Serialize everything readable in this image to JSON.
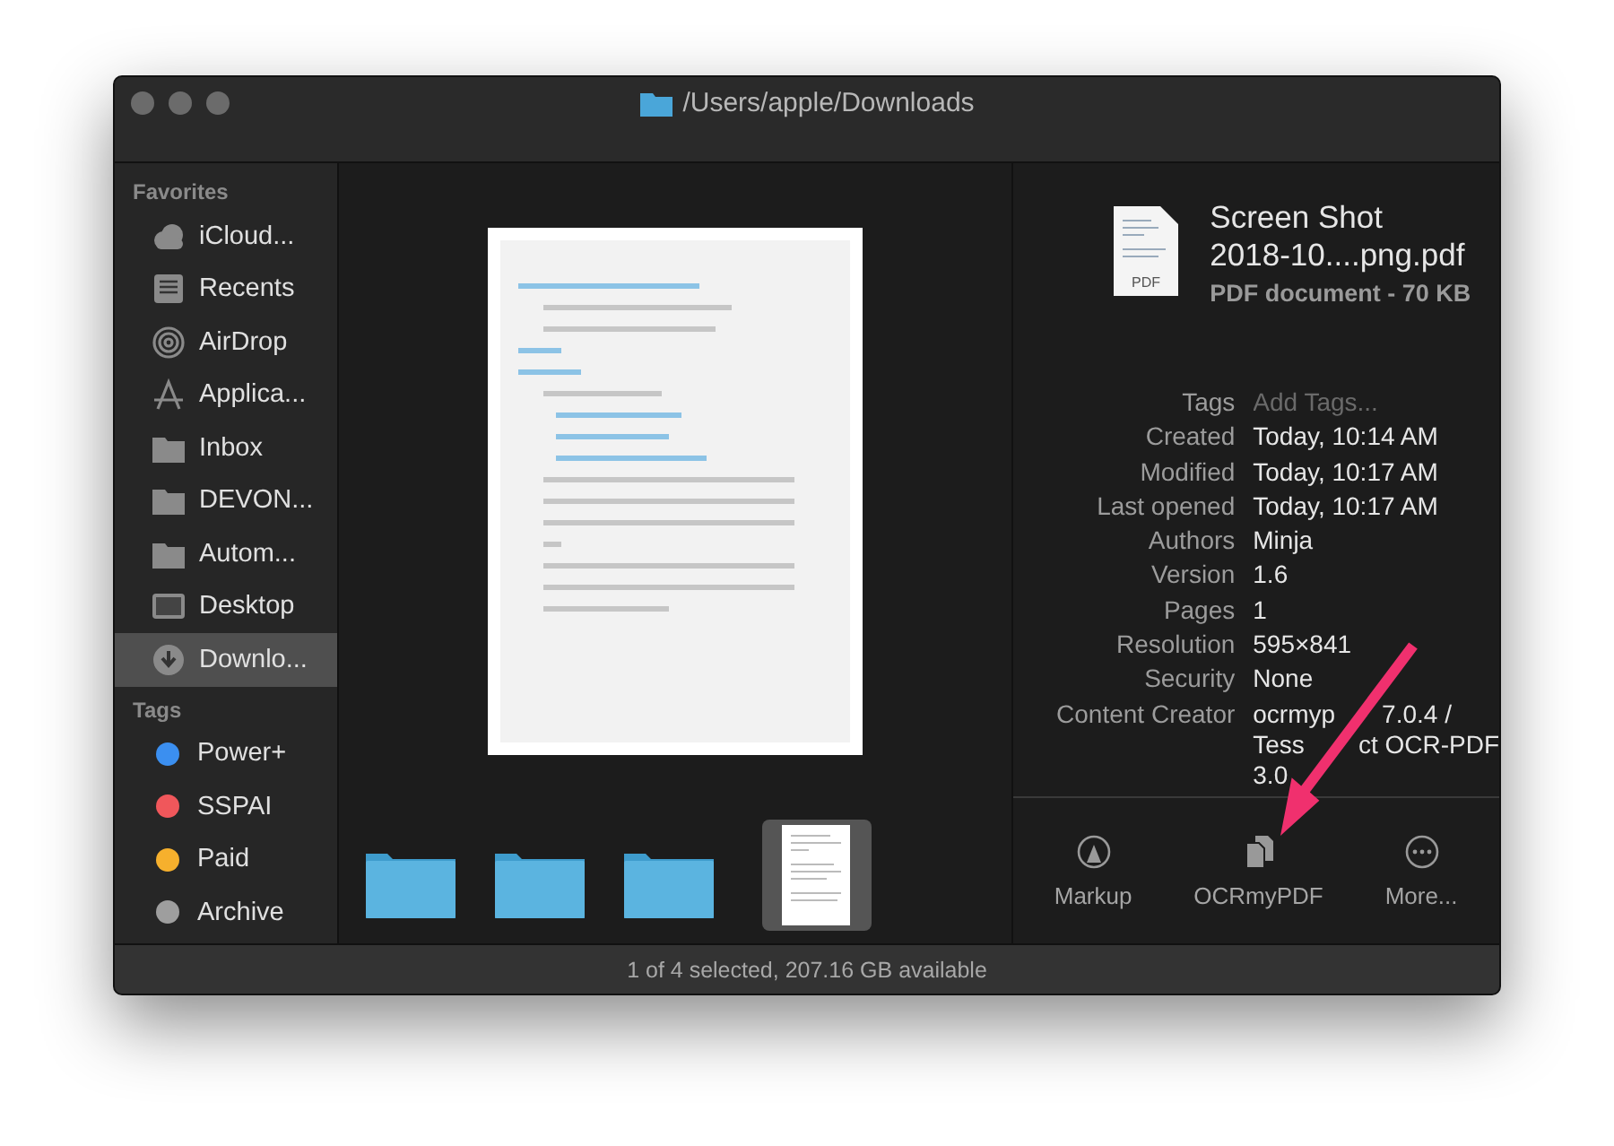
{
  "window": {
    "title": "/Users/apple/Downloads"
  },
  "sidebar": {
    "sections": [
      {
        "title": "Favorites",
        "kind": "places",
        "items": [
          {
            "label": "iCloud...",
            "selected": false
          },
          {
            "label": "Recents",
            "selected": false
          },
          {
            "label": "AirDrop",
            "selected": false
          },
          {
            "label": "Applica...",
            "selected": false
          },
          {
            "label": "Inbox",
            "selected": false
          },
          {
            "label": "DEVON...",
            "selected": false
          },
          {
            "label": "Autom...",
            "selected": false
          },
          {
            "label": "Desktop",
            "selected": false
          },
          {
            "label": "Downlo...",
            "selected": true
          }
        ]
      },
      {
        "title": "Tags",
        "kind": "tags",
        "items": [
          {
            "label": "Power+",
            "color": "#3b8ff0"
          },
          {
            "label": "SSPAI",
            "color": "#f0575b"
          },
          {
            "label": "Paid",
            "color": "#f6b02d"
          },
          {
            "label": "Archive",
            "color": "#9e9e9e"
          }
        ]
      }
    ]
  },
  "gallery": {
    "items": [
      {
        "kind": "folder",
        "selected": false
      },
      {
        "kind": "folder",
        "selected": false
      },
      {
        "kind": "folder",
        "selected": false
      },
      {
        "kind": "document",
        "selected": true
      }
    ]
  },
  "inspector": {
    "name_lines": [
      "Screen Shot",
      "2018-10....png.pdf"
    ],
    "file_badge": "PDF",
    "subtitle": "PDF document - 70 KB",
    "metadata": [
      {
        "label": "Tags",
        "kind": "field",
        "placeholder": "Add Tags..."
      },
      {
        "label": "Created",
        "kind": "text",
        "value": "Today, 10:14 AM"
      },
      {
        "label": "Modified",
        "kind": "text",
        "value": "Today, 10:17 AM"
      },
      {
        "label": "Last opened",
        "kind": "text",
        "value": "Today, 10:17 AM"
      },
      {
        "label": "Authors",
        "kind": "text",
        "value": "Minja"
      },
      {
        "label": "Version",
        "kind": "text",
        "value": "1.6"
      },
      {
        "label": "Pages",
        "kind": "text",
        "value": "1"
      },
      {
        "label": "Resolution",
        "kind": "text",
        "value": "595×841"
      },
      {
        "label": "Security",
        "kind": "text",
        "value": "None"
      },
      {
        "label": "Content Creator",
        "kind": "lines",
        "value_lines": [
          [
            "ocrmyp",
            "7.0.4 /"
          ],
          [
            "Tess",
            "ct OCR-PDF"
          ],
          [
            "3.0"
          ]
        ]
      }
    ],
    "actions": [
      {
        "label": "Markup",
        "kind": "markup"
      },
      {
        "label": "OCRmyPDF",
        "kind": "copy"
      },
      {
        "label": "More...",
        "kind": "more"
      }
    ]
  },
  "status_bar": "1 of 4 selected, 207.16 GB available"
}
